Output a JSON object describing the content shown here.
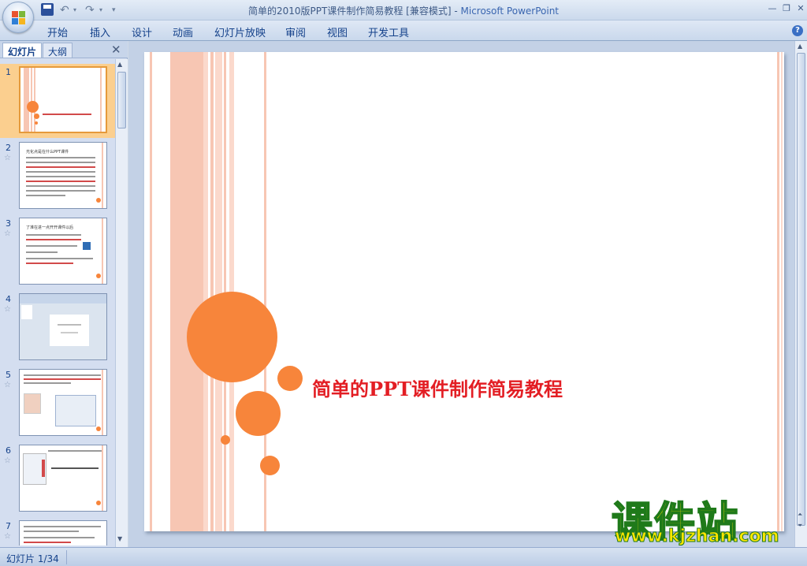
{
  "window": {
    "title": "简单的2010版PPT课件制作简易教程 [兼容模式]",
    "separator": " - ",
    "app_name": "Microsoft PowerPoint"
  },
  "quick_access": {
    "undo_icon": "undo-icon",
    "redo_icon": "redo-icon",
    "save_icon": "save-icon"
  },
  "ribbon": {
    "tabs": [
      "开始",
      "插入",
      "设计",
      "动画",
      "幻灯片放映",
      "审阅",
      "视图",
      "开发工具"
    ]
  },
  "panel": {
    "tabs": {
      "slides": "幻灯片",
      "outline": "大纲"
    },
    "thumbnails": [
      {
        "num": "1"
      },
      {
        "num": "2",
        "title": "光化点是在什么PPT课件"
      },
      {
        "num": "3",
        "title": "了准在进一点开开课件以后"
      },
      {
        "num": "4"
      },
      {
        "num": "5"
      },
      {
        "num": "6"
      },
      {
        "num": "7"
      }
    ]
  },
  "slide": {
    "title": "简单的PPT课件制作简易教程"
  },
  "watermark": {
    "logo": "课件站",
    "url": "www.kjzhan.com"
  },
  "status": {
    "slide_counter": "幻灯片 1/34"
  },
  "colors": {
    "accent_orange": "#f7853b",
    "stripe_pink": "#f7c6b3",
    "title_red": "#e31e24",
    "selected_thumb": "#fbcf8f"
  }
}
